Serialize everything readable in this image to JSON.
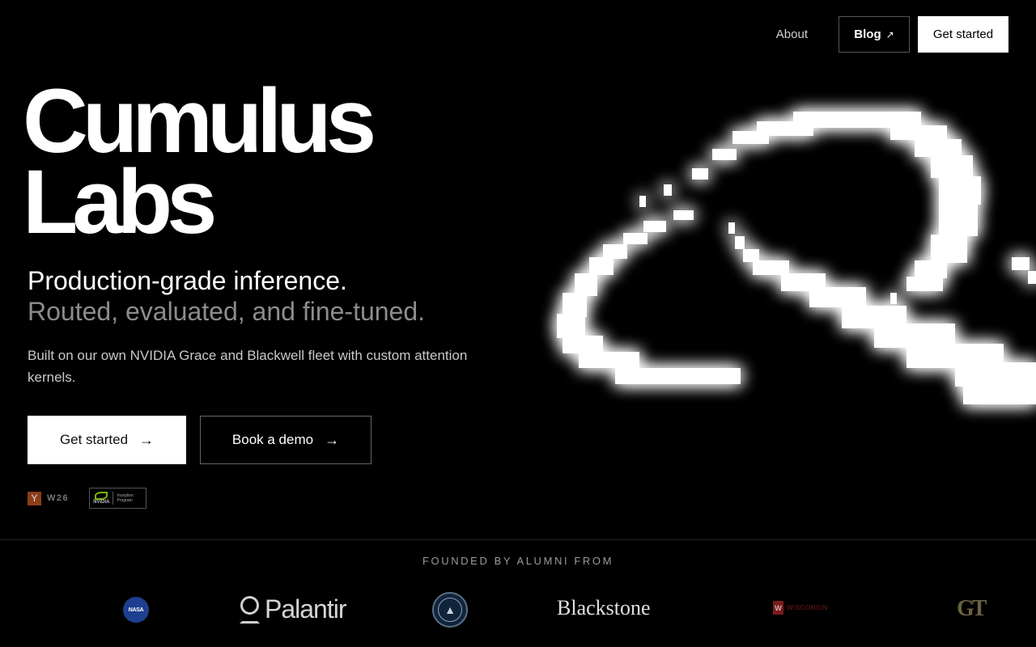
{
  "nav": {
    "about": "About",
    "blog": "Blog",
    "blog_icon": "arrow-up-right-icon",
    "get_started": "Get started"
  },
  "hero": {
    "title_line1": "Cumulus",
    "title_line2": "Labs",
    "tagline_line1": "Production-grade inference.",
    "tagline_line2": "Routed, evaluated, and fine-tuned.",
    "description": "Built on our own NVIDIA Grace and Blackwell fleet with custom attention kernels.",
    "primary_button": "Get started",
    "secondary_button": "Book a demo",
    "button_icon": "arrow-right-icon"
  },
  "badges": {
    "yc_letter": "Y",
    "yc_batch": "W26",
    "nvidia_name": "NVIDIA",
    "nvidia_program_line1": "Inception",
    "nvidia_program_line2": "Program"
  },
  "founders": {
    "heading": "FOUNDED BY ALUMNI FROM",
    "nasa": "NASA",
    "palantir": "Palantir",
    "blackstone": "Blackstone",
    "wisconsin": "WISCONSIN",
    "wisconsin_crest": "W",
    "georgia_tech": "GT"
  },
  "colors": {
    "background": "#000000",
    "primary_button": "#ffffff",
    "muted_text": "#8c8c8c",
    "nvidia_green": "#76b900",
    "yc_orange": "#8a3d1a"
  }
}
